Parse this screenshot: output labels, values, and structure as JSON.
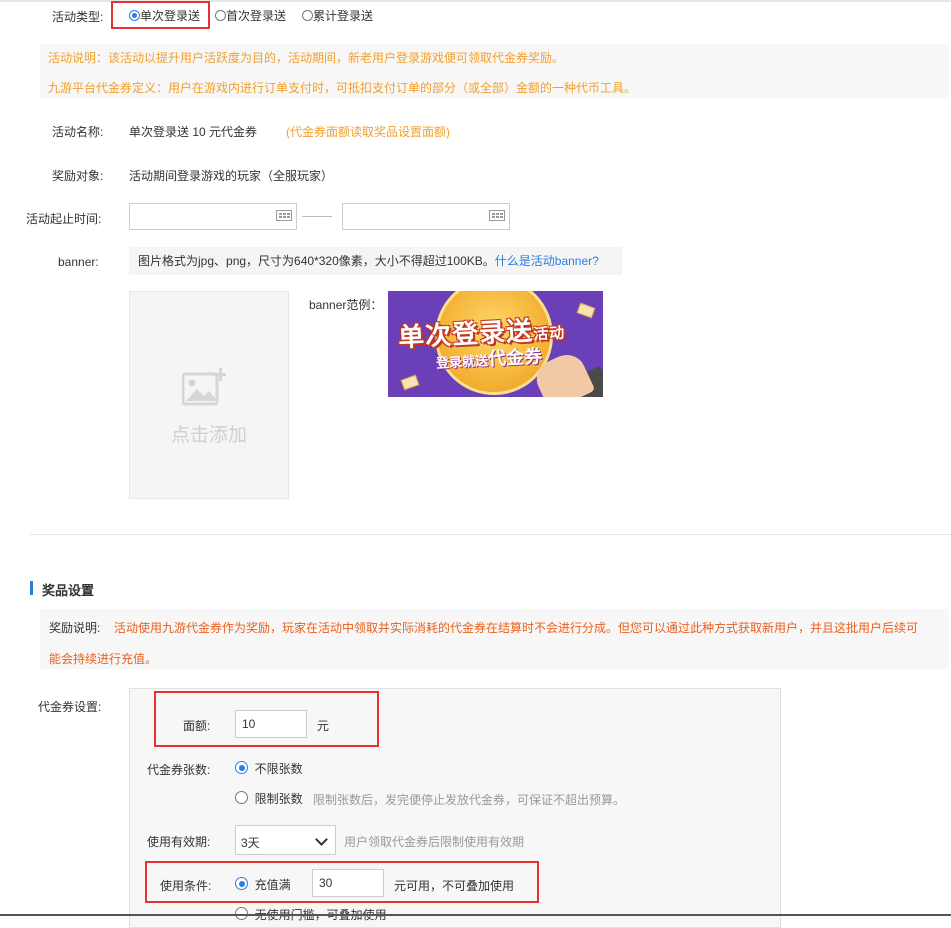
{
  "activity_type": {
    "label": "活动类型:",
    "options": [
      {
        "label": "单次登录送",
        "selected": true
      },
      {
        "label": "首次登录送",
        "selected": false
      },
      {
        "label": "累计登录送",
        "selected": false
      }
    ]
  },
  "notice": {
    "line1": "活动说明：该活动以提升用户活跃度为目的，活动期间，新老用户登录游戏便可领取代金券奖励。",
    "line2": "九游平台代金券定义：用户在游戏内进行订单支付时，可抵扣支付订单的部分（或全部）金额的一种代币工具。"
  },
  "activity_name": {
    "label": "活动名称:",
    "value": "单次登录送 10 元代金券",
    "hint": "(代金券面额读取奖品设置面额)"
  },
  "reward_target": {
    "label": "奖励对象:",
    "value": "活动期间登录游戏的玩家（全服玩家）"
  },
  "time_range": {
    "label": "活动起止时间:",
    "start_value": "",
    "end_value": ""
  },
  "banner": {
    "label": "banner:",
    "info": "图片格式为jpg、png，尺寸为640*320像素，大小不得超过100KB。",
    "link": "什么是活动banner?",
    "upload_text": "点击添加",
    "example_label": "banner范例：",
    "example_title": "单次登录送",
    "example_title_suffix": "活动",
    "example_sub": "登录就送",
    "example_sub_big": "代金券"
  },
  "prize_section": {
    "title": "奖品设置",
    "desc_label": "奖励说明:",
    "desc_line1": "活动使用九游代金券作为奖励，玩家在活动中领取并实际消耗的代金券在结算时不会进行分成。但您可以通过此种方式获取新用户，并且这批用户后续可",
    "desc_line2": "能会持续进行充值。"
  },
  "voucher": {
    "label": "代金券设置:",
    "face_label": "面额:",
    "face_value": "10",
    "face_unit": "元",
    "count_label": "代金券张数:",
    "count_unlimited": "不限张数",
    "count_limited": "限制张数",
    "count_limited_note": "限制张数后，发完便停止发放代金券，可保证不超出预算。",
    "validity_label": "使用有效期:",
    "validity_value": "3天",
    "validity_note": "用户领取代金券后限制使用有效期",
    "condition_label": "使用条件:",
    "condition_recharge": "充值满",
    "condition_value": "30",
    "condition_suffix": "元可用，不可叠加使用",
    "condition_none": "无使用门槛，可叠加使用"
  },
  "colors": {
    "accent": "#2a7de1",
    "highlight_border": "#e53333",
    "notice_text": "#f0a030",
    "warning_text": "#e8621f",
    "panel_bg": "#f7f7f7"
  }
}
